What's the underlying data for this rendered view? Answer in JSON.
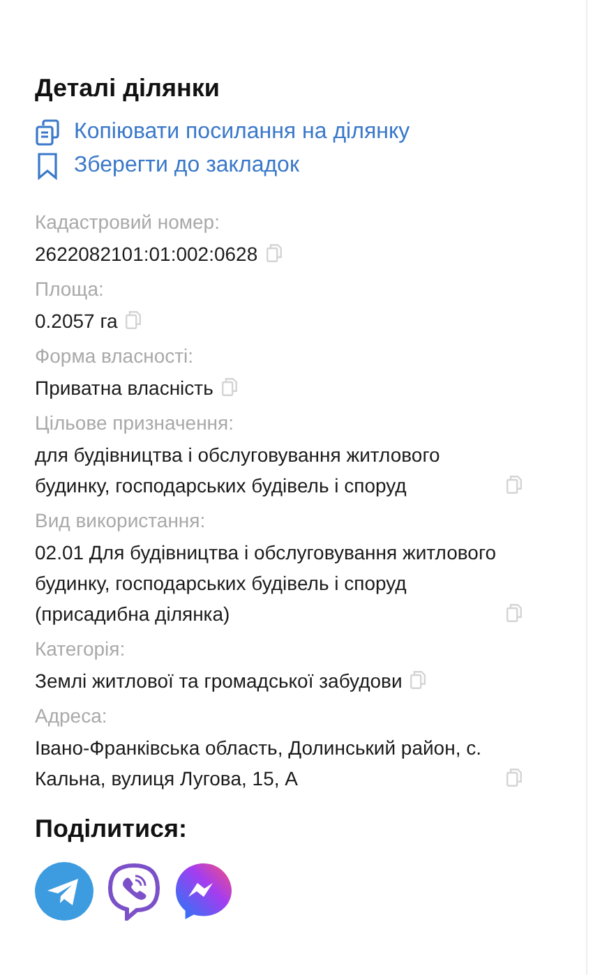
{
  "title": "Деталі ділянки",
  "actions": [
    {
      "kind": "copy",
      "label": "Копіювати посилання на ділянку"
    },
    {
      "kind": "bookmark",
      "label": "Зберегти до закладок"
    }
  ],
  "fields": [
    {
      "label": "Кадастровий номер:",
      "value": "2622082101:01:002:0628"
    },
    {
      "label": "Площа:",
      "value": "0.2057 га"
    },
    {
      "label": "Форма власності:",
      "value": "Приватна власність"
    },
    {
      "label": "Цільове призначення:",
      "value": "для будівництва і обслуговування житлового будинку, господарських будівель і споруд"
    },
    {
      "label": "Вид використання:",
      "value": "02.01 Для будівництва і обслуговування житлового будинку, господарських будівель і споруд (присадибна ділянка)"
    },
    {
      "label": "Категорія:",
      "value": "Землі житлової та громадської забудови"
    },
    {
      "label": "Адреса:",
      "value": "Івано-Франківська область, Долинський район, с. Кальна, вулиця Лугова, 15, А"
    }
  ],
  "share": {
    "title": "Поділитися:",
    "buttons": [
      {
        "kind": "telegram"
      },
      {
        "kind": "viber"
      },
      {
        "kind": "messenger"
      }
    ]
  }
}
